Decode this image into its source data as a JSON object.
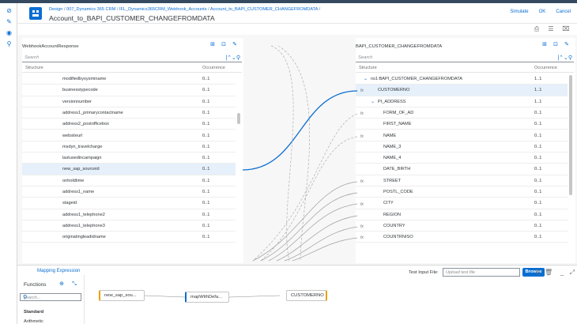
{
  "header": {
    "breadcrumb": [
      "Design",
      "007_Dynamics 365 CRM",
      "IFL_Dynamics365CRM_Webhook_Accounts",
      "Account_to_BAPI_CUSTOMER_CHANGEFROMDATA"
    ],
    "title": "Account_to_BAPI_CUSTOMER_CHANGEFROMDATA",
    "actions": {
      "simulate": "Simulate",
      "ok": "OK",
      "cancel": "Cancel"
    }
  },
  "source": {
    "title": "WebhookAccountResponse",
    "search_placeholder": "Search",
    "col_structure": "Structure",
    "col_occurrence": "Occurrence",
    "rows": [
      {
        "name": "modifiedbysysminame",
        "occ": "0..1"
      },
      {
        "name": "businesstypecode",
        "occ": "0..1"
      },
      {
        "name": "versionnumber",
        "occ": "0..1"
      },
      {
        "name": "address1_primarycontactname",
        "occ": "0..1"
      },
      {
        "name": "address2_postofficebox",
        "occ": "0..1"
      },
      {
        "name": "websiteurl",
        "occ": "0..1"
      },
      {
        "name": "msdyn_travelcharge",
        "occ": "0..1"
      },
      {
        "name": "lastusedincampaign",
        "occ": "0..1"
      },
      {
        "name": "new_sap_sourceid",
        "occ": "0..1"
      },
      {
        "name": "onholdtime",
        "occ": "0..1"
      },
      {
        "name": "address1_name",
        "occ": "0..1"
      },
      {
        "name": "stageid",
        "occ": "0..1"
      },
      {
        "name": "address1_telephone2",
        "occ": "0..1"
      },
      {
        "name": "address1_telephone3",
        "occ": "0..1"
      },
      {
        "name": "originatingleadidname",
        "occ": "0..1"
      }
    ]
  },
  "target": {
    "title": "BAPI_CUSTOMER_CHANGEFROMDATA",
    "search_placeholder": "Search",
    "col_structure": "Structure",
    "col_occurrence": "Occurrence",
    "rows": [
      {
        "name": "ns1:BAPI_CUSTOMER_CHANGEFROMDATA",
        "occ": "1..1"
      },
      {
        "name": "CUSTOMERNO",
        "occ": "1..1"
      },
      {
        "name": "PI_ADDRESS",
        "occ": "1..1"
      },
      {
        "name": "FORM_OF_AD",
        "occ": "0..1"
      },
      {
        "name": "FIRST_NAME",
        "occ": "0..1"
      },
      {
        "name": "NAME",
        "occ": "0..1"
      },
      {
        "name": "NAME_3",
        "occ": "0..1"
      },
      {
        "name": "NAME_4",
        "occ": "0..1"
      },
      {
        "name": "DATE_BIRTH",
        "occ": "0..1"
      },
      {
        "name": "STREET",
        "occ": "0..1"
      },
      {
        "name": "POSTL_CODE",
        "occ": "0..1"
      },
      {
        "name": "CITY",
        "occ": "0..1"
      },
      {
        "name": "REGION",
        "occ": "0..1"
      },
      {
        "name": "COUNTRY",
        "occ": "0..1"
      },
      {
        "name": "COUNTRNISO",
        "occ": "0..1"
      }
    ]
  },
  "mapping": {
    "tab_label": "Mapping Expression",
    "test_input_label": "Test Input File:",
    "test_input_placeholder": "Upload test file",
    "browse_label": "Browse",
    "functions_title": "Functions",
    "functions_search_placeholder": "Search...",
    "standard_label": "Standard",
    "arithmetic_label": "Arithmetic",
    "node_source": "new_sap_sou...",
    "node_function": "mapWithDefa...",
    "node_target": "CUSTOMERNO"
  },
  "colors": {
    "accent": "#0a6ed1",
    "shell": "#354a5f",
    "selected_row": "#e5f0fa",
    "mapping_line": "#0a6ed1",
    "dashed_line": "#b0b0b0"
  }
}
